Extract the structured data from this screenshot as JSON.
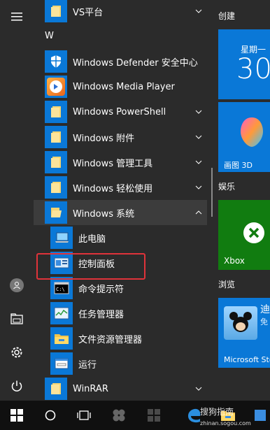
{
  "left_rail": {
    "menu_icon": "hamburger-menu-icon",
    "user_icon": "user-avatar-icon",
    "documents_icon": "documents-icon",
    "settings_icon": "gear-icon",
    "power_icon": "power-icon"
  },
  "app_list": {
    "group_letter": "W",
    "items": [
      {
        "label": "VS平台",
        "icon": "folder-icon",
        "expandable": true
      },
      {
        "label": "Windows Defender 安全中心",
        "icon": "shield-icon",
        "expandable": false
      },
      {
        "label": "Windows Media Player",
        "icon": "media-player-icon",
        "expandable": false
      },
      {
        "label": "Windows PowerShell",
        "icon": "folder-icon",
        "expandable": true
      },
      {
        "label": "Windows 附件",
        "icon": "folder-icon",
        "expandable": true
      },
      {
        "label": "Windows 管理工具",
        "icon": "folder-icon",
        "expandable": true
      },
      {
        "label": "Windows 轻松使用",
        "icon": "folder-icon",
        "expandable": true
      },
      {
        "label": "Windows 系统",
        "icon": "folder-open-icon",
        "expandable": true,
        "expanded": true
      },
      {
        "label": "此电脑",
        "icon": "computer-icon"
      },
      {
        "label": "控制面板",
        "icon": "control-panel-icon",
        "highlighted": true
      },
      {
        "label": "命令提示符",
        "icon": "command-prompt-icon"
      },
      {
        "label": "任务管理器",
        "icon": "task-manager-icon"
      },
      {
        "label": "文件资源管理器",
        "icon": "file-explorer-icon"
      },
      {
        "label": "运行",
        "icon": "run-icon"
      },
      {
        "label": "WinRAR",
        "icon": "folder-icon",
        "expandable": true
      }
    ]
  },
  "tiles": {
    "section_create": "创建",
    "calendar_weekday": "星期一",
    "calendar_day": "30",
    "paint3d_label": "画图 3D",
    "section_entertainment": "娱乐",
    "xbox_label": "Xbox",
    "section_browse": "浏览",
    "store_title": "迪",
    "store_sub": "免",
    "store_label": "Microsoft Store"
  },
  "watermark": {
    "text": "搜狗指南",
    "url": "zhinan.sogou.com"
  },
  "colors": {
    "accent": "#0a78d7",
    "highlight_box": "#e0333a",
    "xbox_green": "#117c10",
    "menu_bg": "#2b2b2b",
    "taskbar_bg": "#101010"
  }
}
